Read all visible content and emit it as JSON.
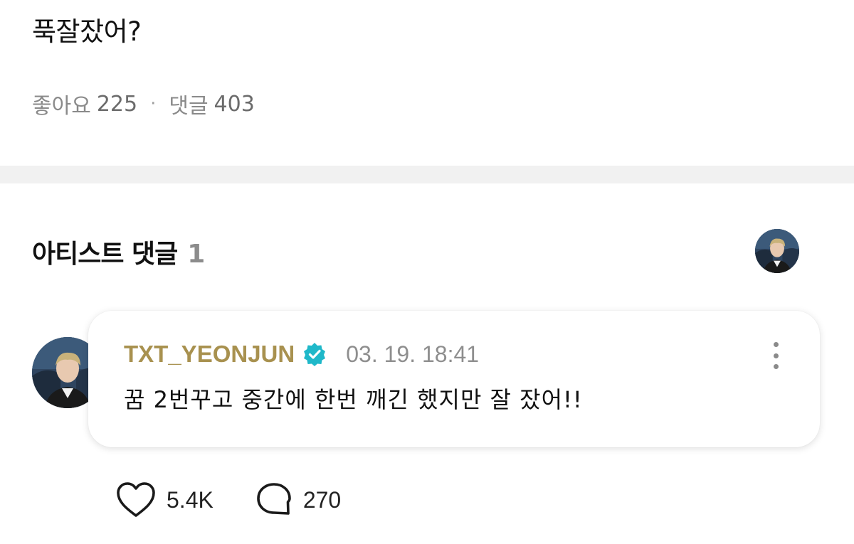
{
  "post": {
    "text": "푹잘잤어?",
    "likes_label": "좋아요",
    "likes_count": "225",
    "separator": "·",
    "comments_label": "댓글",
    "comments_count": "403"
  },
  "artist_comments": {
    "title": "아티스트 댓글",
    "count": "1"
  },
  "comment": {
    "author": "TXT_YEONJUN",
    "verified": true,
    "timestamp": "03. 19. 18:41",
    "text": "꿈 2번꾸고 중간에 한번 깨긴 했지만 잘 잤어!!",
    "likes": "5.4K",
    "replies": "270"
  },
  "icons": {
    "verified": "verified-badge-icon",
    "more": "more-vertical-icon",
    "like": "heart-icon",
    "reply": "speech-bubble-icon"
  },
  "colors": {
    "author": "#a8914f",
    "verified_badge": "#1fb8c9",
    "muted_text": "#8e8e8e",
    "divider_band": "#f1f1f1"
  }
}
